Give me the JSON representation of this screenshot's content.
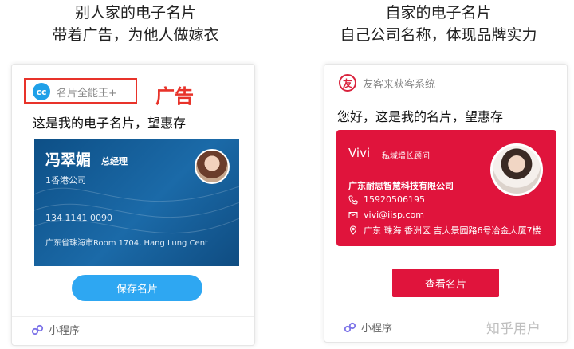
{
  "headings": {
    "left": {
      "line1": "别人家的电子名片",
      "line2": "带着广告，为他人做嫁衣"
    },
    "right": {
      "line1": "自家的电子名片",
      "line2": "自己公司名称，体现品牌实力"
    }
  },
  "left_card": {
    "brand": "名片全能王+",
    "ad_label": "广告",
    "greeting": "这是我的电子名片，望惠存",
    "business_card": {
      "name": "冯翠媚",
      "title": "总经理",
      "company": "1香港公司",
      "phone": "134 1141 0090",
      "address": "广东省珠海市Room 1704, Hang Lung Cent"
    },
    "save_button": "保存名片",
    "footer": "小程序"
  },
  "right_card": {
    "brand": "友客来获客系统",
    "greeting": "您好，这是我的名片，望惠存",
    "business_card": {
      "name": "Vivi",
      "title": "私域增长顾问",
      "company": "广东耐思智慧科技有限公司",
      "phone": "15920506195",
      "email": "vivi@iisp.com",
      "address": "广东 珠海 香洲区 吉大景园路6号冶金大厦7楼"
    },
    "view_button": "查看名片",
    "footer": "小程序"
  },
  "watermark": "知乎用户",
  "colors": {
    "ad_highlight": "#e8332a",
    "left_card_bg": "#1b6aa8",
    "save_button": "#2ea7f2",
    "right_card_bg": "#e0143c"
  },
  "icons": [
    "cc-logo-icon",
    "you-logo-icon",
    "mini-program-icon",
    "phone-icon",
    "email-icon",
    "location-icon"
  ]
}
